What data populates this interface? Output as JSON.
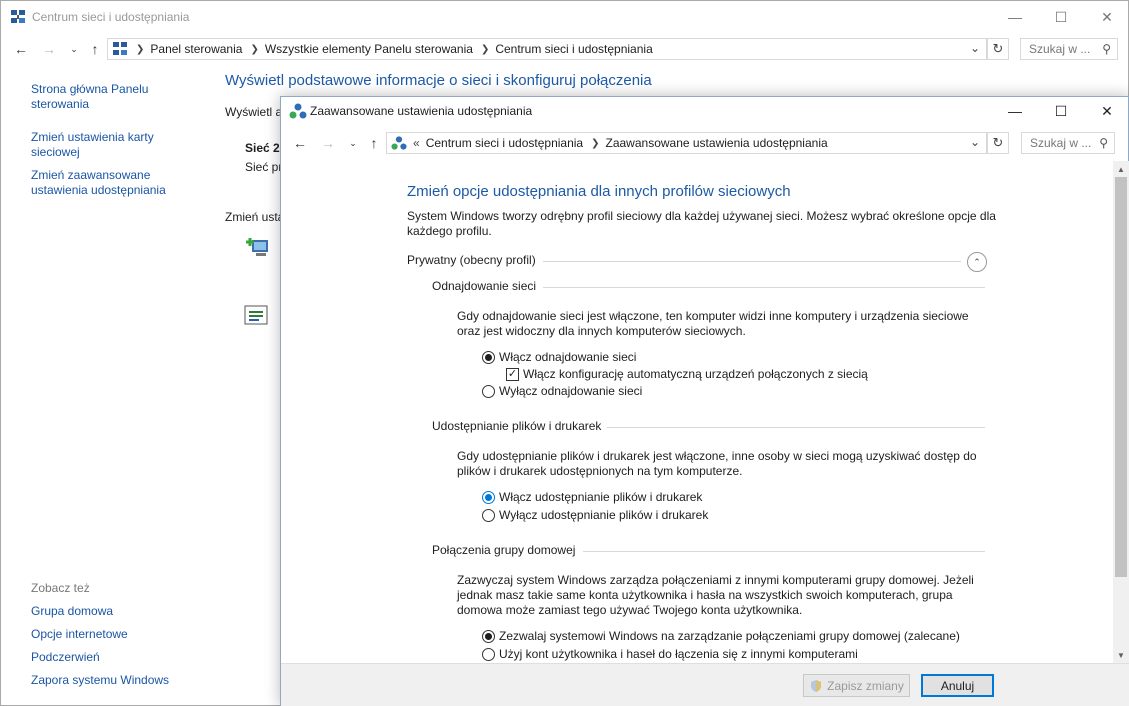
{
  "outer": {
    "title": "Centrum sieci i udostępniania",
    "breadcrumbs": [
      "Panel sterowania",
      "Wszystkie elementy Panelu sterowania",
      "Centrum sieci i udostępniania"
    ],
    "search_placeholder": "Szukaj w ...",
    "left_nav": [
      "Strona główna Panelu sterowania",
      "Zmień ustawienia karty sieciowej",
      "Zmień zaawansowane ustawienia udostępniania"
    ],
    "see_also_label": "Zobacz też",
    "see_also": [
      "Grupa domowa",
      "Opcje internetowe",
      "Podczerwień",
      "Zapora systemu Windows"
    ],
    "main_title": "Wyświetl podstawowe informacje o sieci i skonfiguruj połączenia",
    "behind": {
      "view_active": "Wyświetl a",
      "network_name": "Sieć 2",
      "network_sub": "Sieć pr",
      "change_label": "Zmień usta"
    }
  },
  "inner": {
    "title": "Zaawansowane ustawienia udostępniania",
    "breadcrumb_prefix": "«",
    "breadcrumbs": [
      "Centrum sieci i udostępniania",
      "Zaawansowane ustawienia udostępniania"
    ],
    "search_placeholder": "Szukaj w ...",
    "heading": "Zmień opcje udostępniania dla innych profilów sieciowych",
    "intro": "System Windows tworzy odrębny profil sieciowy dla każdej używanej sieci. Możesz wybrać określone opcje dla każdego profilu.",
    "profile_label": "Prywatny (obecny profil)",
    "sections": {
      "discovery": {
        "title": "Odnajdowanie sieci",
        "desc": "Gdy odnajdowanie sieci jest włączone, ten komputer widzi inne komputery i urządzenia sieciowe oraz jest widoczny dla innych komputerów sieciowych.",
        "opt_on": "Włącz odnajdowanie sieci",
        "opt_auto": "Włącz konfigurację automatyczną urządzeń połączonych z siecią",
        "opt_off": "Wyłącz odnajdowanie sieci"
      },
      "sharing": {
        "title": "Udostępnianie plików i drukarek",
        "desc": "Gdy udostępnianie plików i drukarek jest włączone, inne osoby w sieci mogą uzyskiwać dostęp do plików i drukarek udostępnionych na tym komputerze.",
        "opt_on": "Włącz udostępnianie plików i drukarek",
        "opt_off": "Wyłącz udostępnianie plików i drukarek"
      },
      "homegroup": {
        "title": "Połączenia grupy domowej",
        "desc": "Zazwyczaj system Windows zarządza połączeniami z innymi komputerami grupy domowej. Jeżeli jednak masz takie same konta użytkownika i hasła na wszystkich swoich komputerach, grupa domowa może zamiast tego używać Twojego konta użytkownika.",
        "opt_allow": "Zezwalaj systemowi Windows na zarządzanie połączeniami grupy domowej (zalecane)",
        "opt_accounts": "Użyj kont użytkownika i haseł do łączenia się z innymi komputerami"
      }
    },
    "buttons": {
      "save": "Zapisz zmiany",
      "cancel": "Anuluj"
    }
  }
}
